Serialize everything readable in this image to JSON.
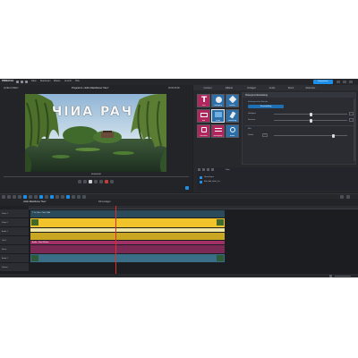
{
  "app": {
    "logo_text": "PINNACLE",
    "menu": [
      "Datei",
      "Bearbeiten",
      "Effekte",
      "Ansicht",
      "Hilfe"
    ],
    "title_preview": "Programm: clotho Marsblume \"Neu\"",
    "export_button": "Exportieren"
  },
  "preview": {
    "source_label": "QUELLVIDEO",
    "time_label": "00:00:08:08",
    "title_text": "ЧIИA PAЧ",
    "timecode": "00:00:05:08",
    "playback_marker": "▲"
  },
  "library_tabs": [
    "Content",
    "Effekte",
    "Vorlagen",
    "Audio",
    "Stock",
    "Rekorder"
  ],
  "effects": {
    "panel_title": "Hintergrund Einstellung",
    "group1_label": "Hintergrund im Einsatz",
    "preset_button": "Voreinstellung",
    "param1": "Helligkeit",
    "param2": "Kontrast",
    "group2_label": "Blur",
    "param3": "Stärke",
    "param3_value": "0",
    "tiles": [
      {
        "label": "Titel"
      },
      {
        "label": "Übergang"
      },
      {
        "label": "Effekte"
      },
      {
        "label": "Bild"
      },
      {
        "label": "Farbe"
      },
      {
        "label": "Werkzeug"
      },
      {
        "label": "Stichwort"
      },
      {
        "label": "Bewegung"
      },
      {
        "label": "Audio"
      }
    ],
    "mini_tree_header": "Filter",
    "mini_tree_items": [
      "Hinzufügen",
      "Bild_AA_Hallo_Ihr"
    ]
  },
  "timeline": {
    "tab1": "clotho Marsblume \"Neu\"",
    "tab2": "Filmvorlagen",
    "track_names": [
      "Video 1",
      "Video 2",
      "Audio 1",
      "Titel 1",
      "Musik",
      "Audio 2",
      "Stimme"
    ],
    "clip_title1": "T 1s - Neu - Titel - Bild",
    "clip_audio_label": "Audio - Datei Mellow"
  },
  "colors": {
    "accent": "#1e8ee6",
    "clip_yellow": "#f2c42c",
    "clip_magenta": "#7b2a55",
    "clip_blue": "#3a6e86",
    "clip_light": "#efe6a4",
    "playhead": "#e02b2b"
  }
}
